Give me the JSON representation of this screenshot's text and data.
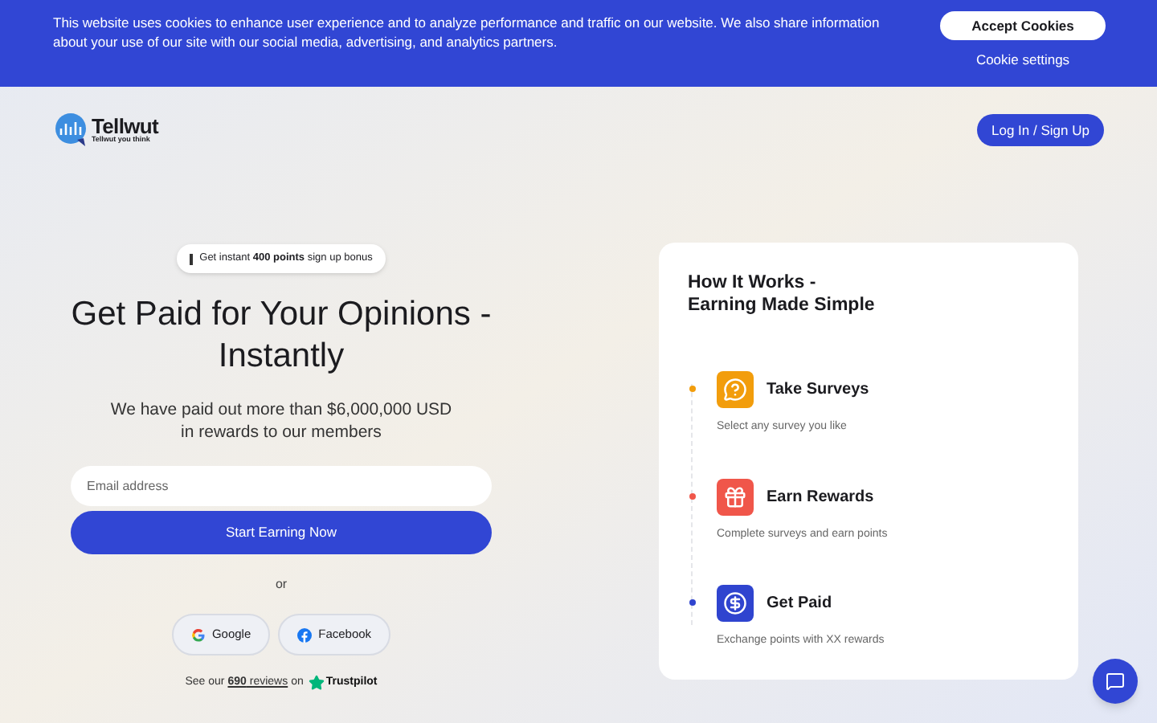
{
  "cookie_banner": {
    "message": "This website uses cookies to enhance user experience and to analyze performance and traffic on our website. We also share information about your use of our site with our social media, advertising, and analytics partners.",
    "accept_button": "Accept Cookies",
    "settings_link": "Cookie settings"
  },
  "header": {
    "logo_name": "Tellwut",
    "logo_tagline": "Tellwut you think",
    "login_button": "Log In / Sign Up"
  },
  "hero": {
    "badge": "Get instant **400 points** sign up bonus",
    "title": "Get Paid for Your Opinions - Instantly",
    "subtitle_lines": [
      "We have paid out more than $6,000,000 USD",
      "in rewards to our members"
    ],
    "email_field": {
      "placeholder": "Email address"
    },
    "submit_button": "Start Earning Now",
    "divider": "or",
    "social_buttons": [
      {
        "kind": "google",
        "label": "Google"
      },
      {
        "kind": "facebook",
        "label": "Facebook"
      }
    ],
    "reviews": {
      "prefix": "See our",
      "link": "**690** reviews",
      "suffix": "on",
      "brand": "Trustpilot"
    }
  },
  "how_it_works": {
    "title_lines": [
      "How It Works -",
      "Earning Made Simple"
    ],
    "steps": [
      {
        "kind": "survey",
        "color": "#f29d0c",
        "title": "Take Surveys",
        "description": "Select any survey you like"
      },
      {
        "kind": "reward",
        "color": "#f0564a",
        "title": "Earn Rewards",
        "description": "Complete surveys and earn points"
      },
      {
        "kind": "pay",
        "color": "#2f44cf",
        "title": "Get Paid",
        "description": "Exchange points with XX rewards"
      }
    ]
  }
}
